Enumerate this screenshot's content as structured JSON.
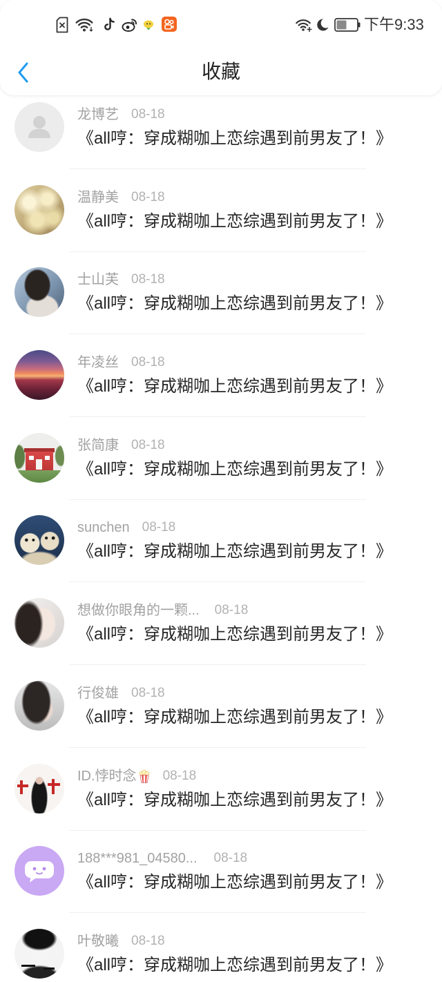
{
  "status_bar": {
    "time": "下午9:33",
    "left_icons": [
      "sim-off-icon",
      "wifi-icon",
      "tiktok-icon",
      "weibo-icon",
      "app-bird-icon",
      "kuaishou-icon"
    ],
    "right_icons": [
      "wifi-signal-icon",
      "moon-icon",
      "battery-icon"
    ],
    "battery_level": 0.5
  },
  "header": {
    "title": "收藏",
    "back_icon": "chevron-left-icon"
  },
  "colors": {
    "accent": "#1e9bf0",
    "title_text": "#262626",
    "meta_text": "#a2a2a2"
  },
  "favorites": [
    {
      "name": "龙博艺",
      "date": "08-18",
      "title": "《all哼：穿成糊咖上恋综遇到前男友了！》"
    },
    {
      "name": "温静美",
      "date": "08-18",
      "title": "《all哼：穿成糊咖上恋综遇到前男友了！》"
    },
    {
      "name": "士山芙",
      "date": "08-18",
      "title": "《all哼：穿成糊咖上恋综遇到前男友了！》"
    },
    {
      "name": "年凌丝",
      "date": "08-18",
      "title": "《all哼：穿成糊咖上恋综遇到前男友了！》"
    },
    {
      "name": "张简康",
      "date": "08-18",
      "title": "《all哼：穿成糊咖上恋综遇到前男友了！》"
    },
    {
      "name": "sunchen",
      "date": "08-18",
      "title": "《all哼：穿成糊咖上恋综遇到前男友了！》"
    },
    {
      "name": "想做你眼角的一颗...",
      "date": "08-18",
      "title": "《all哼：穿成糊咖上恋综遇到前男友了！》"
    },
    {
      "name": "行俊雄",
      "date": "08-18",
      "title": "《all哼：穿成糊咖上恋综遇到前男友了！》"
    },
    {
      "name": "ID.悖时念",
      "name_emoji": "popcorn-icon",
      "date": "08-18",
      "title": "《all哼：穿成糊咖上恋综遇到前男友了！》"
    },
    {
      "name": "188***981_04580...",
      "date": "08-18",
      "title": "《all哼：穿成糊咖上恋综遇到前男友了！》"
    },
    {
      "name": "叶敬曦",
      "date": "08-18",
      "title": "《all哼：穿成糊咖上恋综遇到前男友了！》"
    }
  ]
}
